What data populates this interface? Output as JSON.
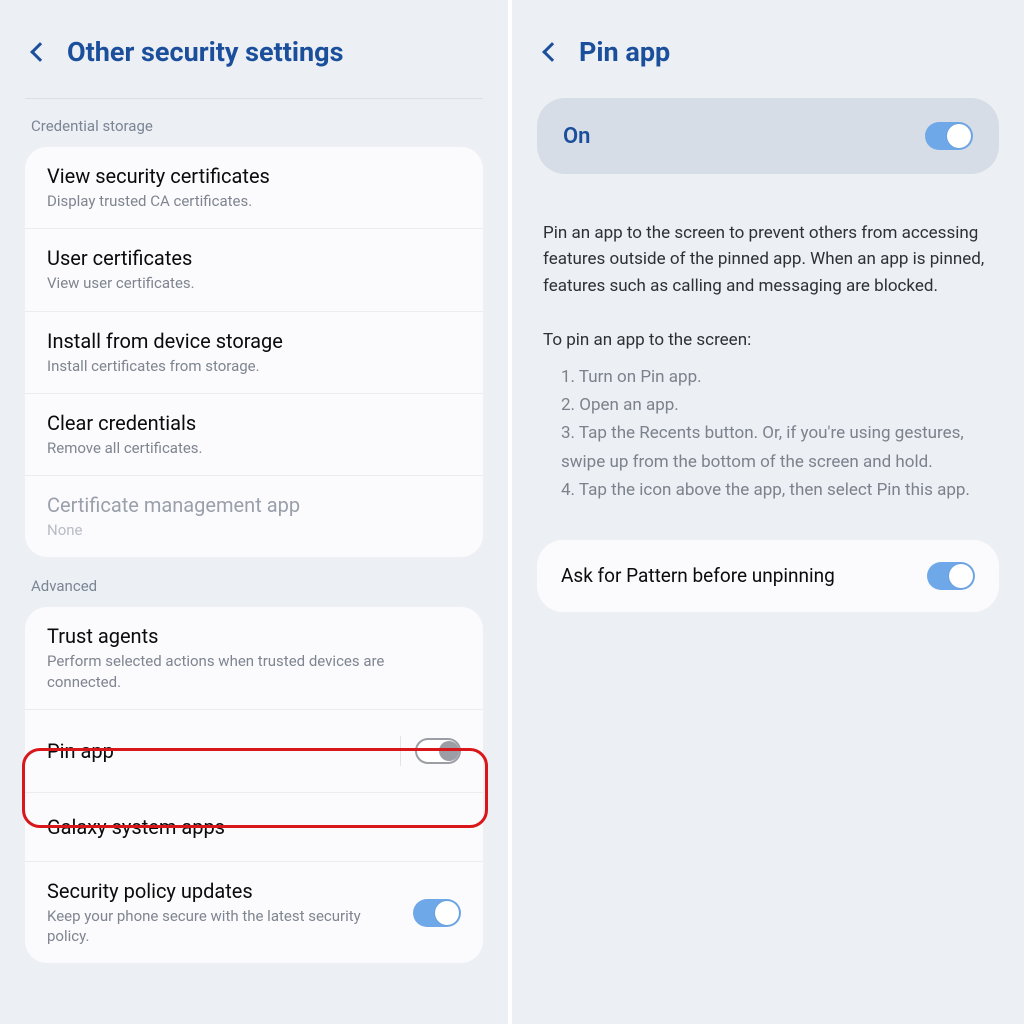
{
  "left": {
    "title": "Other security settings",
    "section_credential": "Credential storage",
    "items": [
      {
        "title": "View security certificates",
        "sub": "Display trusted CA certificates."
      },
      {
        "title": "User certificates",
        "sub": "View user certificates."
      },
      {
        "title": "Install from device storage",
        "sub": "Install certificates from storage."
      },
      {
        "title": "Clear credentials",
        "sub": "Remove all certificates."
      },
      {
        "title": "Certificate management app",
        "sub": "None"
      }
    ],
    "section_advanced": "Advanced",
    "adv": [
      {
        "title": "Trust agents",
        "sub": "Perform selected actions when trusted devices are connected."
      },
      {
        "title": "Pin app"
      },
      {
        "title": "Galaxy system apps"
      },
      {
        "title": "Security policy updates",
        "sub": "Keep your phone secure with the latest security policy."
      }
    ]
  },
  "right": {
    "title": "Pin app",
    "toggle_label": "On",
    "desc1": "Pin an app to the screen to prevent others from accessing features outside of the pinned app. When an app is pinned, features such as calling and messaging are blocked.",
    "desc2": "To pin an app to the screen:",
    "steps": {
      "s1": "1. Turn on Pin app.",
      "s2": "2. Open an app.",
      "s3": "3. Tap the Recents button. Or, if you're using gestures, swipe up from the bottom of the screen and hold.",
      "s4": "4. Tap the icon above the app, then select Pin this app."
    },
    "ask_pattern": "Ask for Pattern before unpinning"
  }
}
